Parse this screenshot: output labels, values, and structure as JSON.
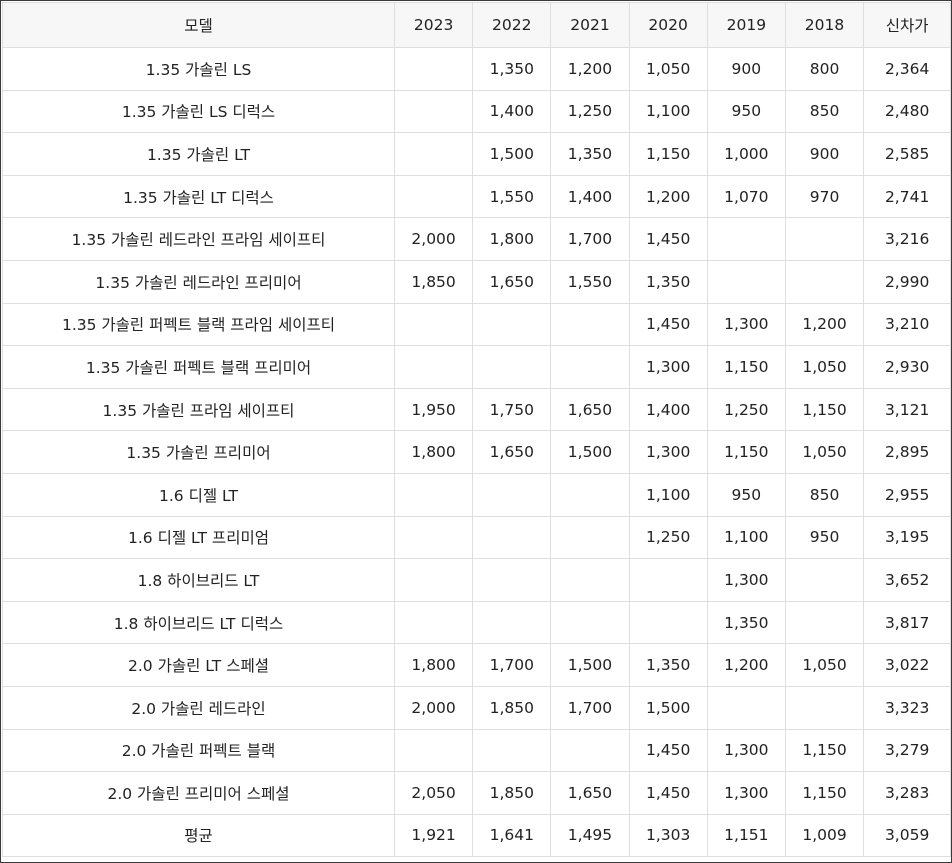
{
  "table": {
    "headers": [
      "모델",
      "2023",
      "2022",
      "2021",
      "2020",
      "2019",
      "2018",
      "신차가"
    ],
    "rows": [
      [
        "1.35 가솔린 LS",
        "",
        "1,350",
        "1,200",
        "1,050",
        "900",
        "800",
        "2,364"
      ],
      [
        "1.35 가솔린 LS 디럭스",
        "",
        "1,400",
        "1,250",
        "1,100",
        "950",
        "850",
        "2,480"
      ],
      [
        "1.35 가솔린 LT",
        "",
        "1,500",
        "1,350",
        "1,150",
        "1,000",
        "900",
        "2,585"
      ],
      [
        "1.35 가솔린 LT 디럭스",
        "",
        "1,550",
        "1,400",
        "1,200",
        "1,070",
        "970",
        "2,741"
      ],
      [
        "1.35 가솔린 레드라인 프라임 세이프티",
        "2,000",
        "1,800",
        "1,700",
        "1,450",
        "",
        "",
        "3,216"
      ],
      [
        "1.35 가솔린 레드라인 프리미어",
        "1,850",
        "1,650",
        "1,550",
        "1,350",
        "",
        "",
        "2,990"
      ],
      [
        "1.35 가솔린 퍼펙트 블랙 프라임 세이프티",
        "",
        "",
        "",
        "1,450",
        "1,300",
        "1,200",
        "3,210"
      ],
      [
        "1.35 가솔린 퍼펙트 블랙 프리미어",
        "",
        "",
        "",
        "1,300",
        "1,150",
        "1,050",
        "2,930"
      ],
      [
        "1.35 가솔린 프라임 세이프티",
        "1,950",
        "1,750",
        "1,650",
        "1,400",
        "1,250",
        "1,150",
        "3,121"
      ],
      [
        "1.35 가솔린 프리미어",
        "1,800",
        "1,650",
        "1,500",
        "1,300",
        "1,150",
        "1,050",
        "2,895"
      ],
      [
        "1.6 디젤 LT",
        "",
        "",
        "",
        "1,100",
        "950",
        "850",
        "2,955"
      ],
      [
        "1.6 디젤 LT 프리미엄",
        "",
        "",
        "",
        "1,250",
        "1,100",
        "950",
        "3,195"
      ],
      [
        "1.8 하이브리드 LT",
        "",
        "",
        "",
        "",
        "1,300",
        "",
        "3,652"
      ],
      [
        "1.8 하이브리드 LT 디럭스",
        "",
        "",
        "",
        "",
        "1,350",
        "",
        "3,817"
      ],
      [
        "2.0 가솔린 LT 스페셜",
        "1,800",
        "1,700",
        "1,500",
        "1,350",
        "1,200",
        "1,050",
        "3,022"
      ],
      [
        "2.0 가솔린 레드라인",
        "2,000",
        "1,850",
        "1,700",
        "1,500",
        "",
        "",
        "3,323"
      ],
      [
        "2.0 가솔린 퍼펙트 블랙",
        "",
        "",
        "",
        "1,450",
        "1,300",
        "1,150",
        "3,279"
      ],
      [
        "2.0 가솔린 프리미어 스페셜",
        "2,050",
        "1,850",
        "1,650",
        "1,450",
        "1,300",
        "1,150",
        "3,283"
      ],
      [
        "평균",
        "1,921",
        "1,641",
        "1,495",
        "1,303",
        "1,151",
        "1,009",
        "3,059"
      ]
    ]
  }
}
